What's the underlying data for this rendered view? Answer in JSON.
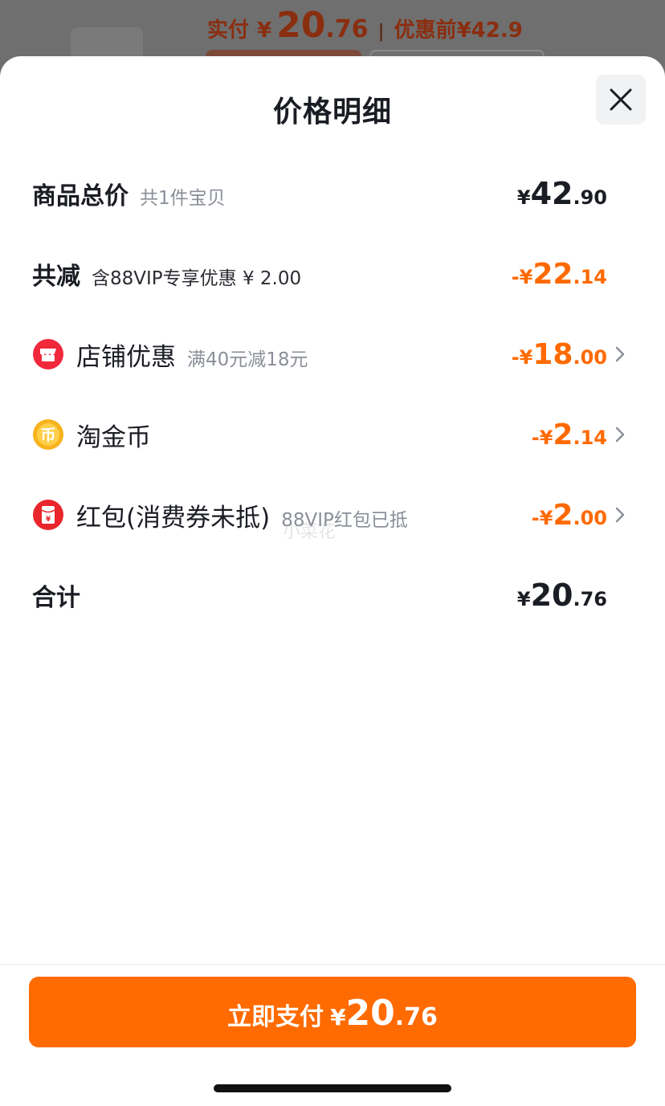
{
  "background": {
    "paid_label": "实付",
    "paid_currency": "¥",
    "paid_int": "20",
    "paid_dec": ".76",
    "separator": "|",
    "original_label": "优惠前",
    "original_price": "¥42.9"
  },
  "sheet": {
    "title": "价格明细",
    "close_icon": "close-icon"
  },
  "rows": [
    {
      "label": "商品总价",
      "sub": "共1件宝贝",
      "currency": "¥",
      "int": "42",
      "dec": ".90",
      "tone": "dark",
      "has_arrow": false
    },
    {
      "label": "共减",
      "sub": "含88VIP专享优惠 ¥ 2.00",
      "currency": "-¥",
      "int": "22",
      "dec": ".14",
      "tone": "orange",
      "has_arrow": false
    },
    {
      "label": "店铺优惠",
      "sub": "满40元减18元",
      "currency": "-¥",
      "int": "18",
      "dec": ".00",
      "tone": "orange",
      "icon": "shop-discount-icon",
      "has_arrow": true
    },
    {
      "label": "淘金币",
      "sub": "",
      "currency": "-¥",
      "int": "2",
      "dec": ".14",
      "tone": "orange",
      "icon": "gold-coin-icon",
      "has_arrow": true
    },
    {
      "label": "红包(消费券未抵)",
      "sub": "88VIP红包已抵",
      "currency": "-¥",
      "int": "2",
      "dec": ".00",
      "tone": "orange",
      "icon": "red-packet-icon",
      "has_arrow": true
    },
    {
      "label": "合计",
      "sub": "",
      "currency": "¥",
      "int": "20",
      "dec": ".76",
      "tone": "dark",
      "has_arrow": false
    }
  ],
  "watermark": "小菜花",
  "pay_button": {
    "label": "立即支付",
    "currency": "¥",
    "int": "20",
    "dec": ".76"
  },
  "colors": {
    "accent": "#ff6b00",
    "amount_orange": "#ff6a00",
    "text_dark": "#1b1d24",
    "text_muted": "#8a8f99",
    "shop_icon": "#f0283c",
    "coin_icon": "#f7b21c",
    "packet_icon": "#e8262b"
  }
}
